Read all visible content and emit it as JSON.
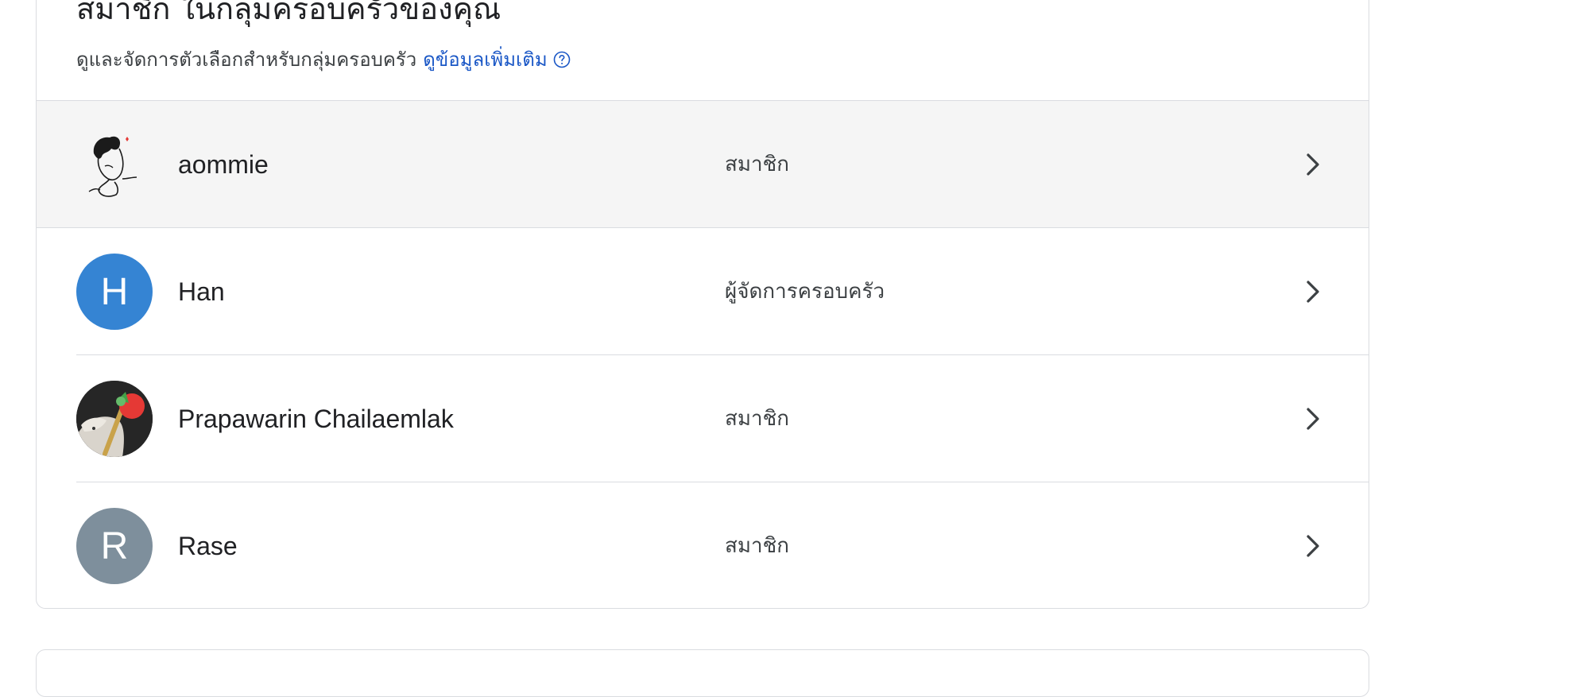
{
  "header": {
    "title": "สมาชิก ในกลุ่มครอบครัวของคุณ",
    "subtitle": "ดูและจัดการตัวเลือกสำหรับกลุ่มครอบครัว",
    "learn_more": "ดูข้อมูลเพิ่มเติม",
    "help_icon": "help-circle-icon"
  },
  "members": [
    {
      "name": "aommie",
      "role": "สมาชิก",
      "avatar_type": "image",
      "avatar_desc": "line-drawing-face"
    },
    {
      "name": "Han",
      "role": "ผู้จัดการครอบครัว",
      "avatar_type": "initial",
      "initial": "H",
      "avatar_color": "#3584d3"
    },
    {
      "name": "Prapawarin Chailaemlak",
      "role": "สมาชิก",
      "avatar_type": "image",
      "avatar_desc": "cat-photo"
    },
    {
      "name": "Rase",
      "role": "สมาชิก",
      "avatar_type": "initial",
      "initial": "R",
      "avatar_color": "#7e8f9c"
    }
  ],
  "colors": {
    "link": "#1a57c6",
    "row_highlight": "#f5f5f5",
    "border": "#dadce0"
  },
  "icons": {
    "row_arrow": "chevron-right-icon"
  }
}
